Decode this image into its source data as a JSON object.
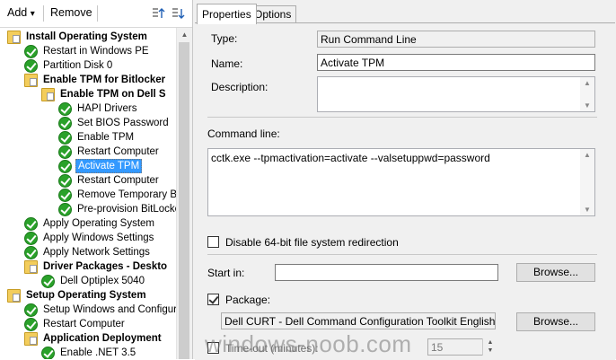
{
  "toolbar": {
    "add_label": "Add",
    "add_arrow": "▾",
    "remove_label": "Remove"
  },
  "tree": [
    {
      "label": "Install Operating System",
      "type": "group",
      "depth": 0,
      "icon": "folder-icon",
      "expanded": true
    },
    {
      "label": "Restart in Windows PE",
      "type": "step",
      "depth": 1,
      "icon": "check-icon"
    },
    {
      "label": "Partition Disk 0",
      "type": "step",
      "depth": 1,
      "icon": "check-icon"
    },
    {
      "label": "Enable TPM for Bitlocker",
      "type": "group",
      "depth": 1,
      "icon": "folder-icon"
    },
    {
      "label": "Enable TPM on Dell S",
      "type": "group",
      "depth": 2,
      "icon": "folder-icon"
    },
    {
      "label": "HAPI Drivers",
      "type": "step",
      "depth": 3,
      "icon": "check-icon"
    },
    {
      "label": "Set BIOS Password",
      "type": "step",
      "depth": 3,
      "icon": "check-icon"
    },
    {
      "label": "Enable TPM",
      "type": "step",
      "depth": 3,
      "icon": "check-icon"
    },
    {
      "label": "Restart Computer",
      "type": "step",
      "depth": 3,
      "icon": "check-icon"
    },
    {
      "label": "Activate TPM",
      "type": "step",
      "depth": 3,
      "icon": "check-icon",
      "selected": true
    },
    {
      "label": "Restart Computer",
      "type": "step",
      "depth": 3,
      "icon": "check-icon"
    },
    {
      "label": "Remove Temporary BI",
      "type": "step",
      "depth": 3,
      "icon": "check-icon"
    },
    {
      "label": "Pre-provision BitLocke",
      "type": "step",
      "depth": 3,
      "icon": "check-icon"
    },
    {
      "label": "Apply Operating System",
      "type": "step",
      "depth": 1,
      "icon": "check-icon"
    },
    {
      "label": "Apply Windows Settings",
      "type": "step",
      "depth": 1,
      "icon": "check-icon"
    },
    {
      "label": "Apply Network Settings",
      "type": "step",
      "depth": 1,
      "icon": "check-icon"
    },
    {
      "label": "Driver Packages - Deskto",
      "type": "group",
      "depth": 1,
      "icon": "folder-icon"
    },
    {
      "label": "Dell Optiplex 5040",
      "type": "step",
      "depth": 2,
      "icon": "check-icon"
    },
    {
      "label": "Setup Operating System",
      "type": "group",
      "depth": 0,
      "icon": "folder-icon",
      "expanded": true
    },
    {
      "label": "Setup Windows and Configura",
      "type": "step",
      "depth": 1,
      "icon": "check-icon"
    },
    {
      "label": "Restart Computer",
      "type": "step",
      "depth": 1,
      "icon": "check-icon"
    },
    {
      "label": "Application Deployment",
      "type": "group",
      "depth": 1,
      "icon": "folder-icon"
    },
    {
      "label": "Enable .NET 3.5",
      "type": "step",
      "depth": 2,
      "icon": "check-icon"
    }
  ],
  "tabs": [
    {
      "label": "Properties",
      "active": true
    },
    {
      "label": "Options",
      "active": false
    }
  ],
  "props": {
    "type_label": "Type:",
    "type_value": "Run Command Line",
    "name_label": "Name:",
    "name_value": "Activate TPM",
    "desc_label": "Description:",
    "desc_value": "",
    "cmd_label": "Command line:",
    "cmd_value": "cctk.exe --tpmactivation=activate --valsetuppwd=password",
    "disable64_label": "Disable 64-bit file system redirection",
    "disable64_checked": false,
    "startin_label": "Start in:",
    "startin_value": "",
    "browse_label": "Browse...",
    "package_label": "Package:",
    "package_checked": true,
    "package_value": "Dell CURT - Dell Command Configuration Toolkit  English",
    "browse2_label": "Browse...",
    "timeout_label": "Time-out (minutes):",
    "timeout_checked": false,
    "timeout_value": "15"
  },
  "watermark": "windows-noob.com"
}
